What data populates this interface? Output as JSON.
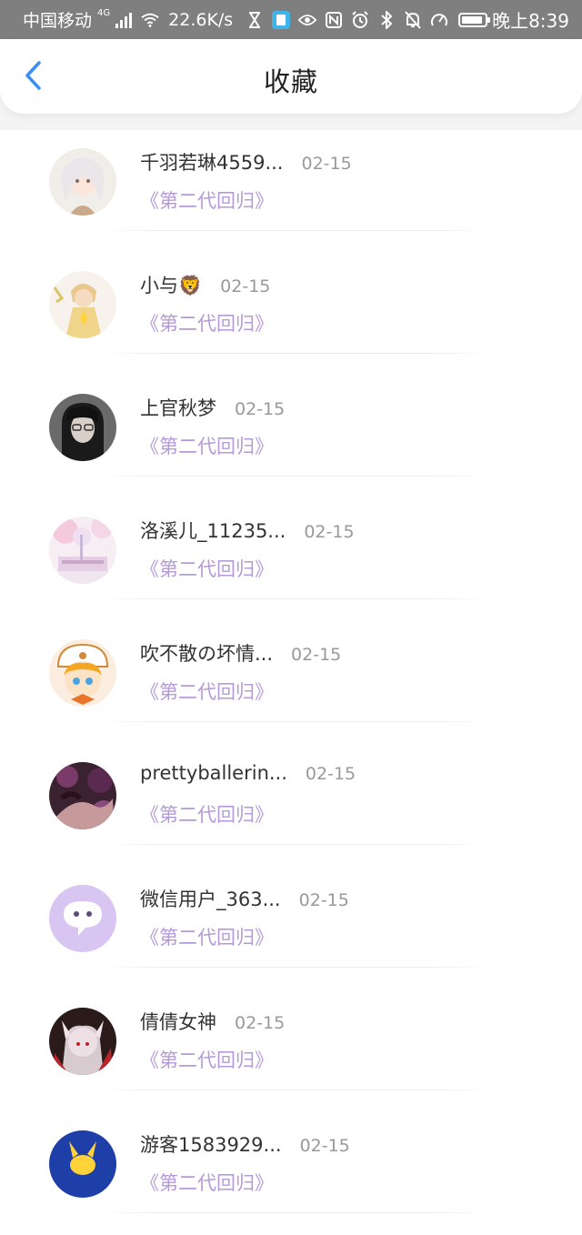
{
  "status_bar": {
    "carrier": "中国移动",
    "network": "4G",
    "speed": "22.6K/s",
    "time": "晚上8:39",
    "battery_level": 0.9
  },
  "header": {
    "title": "收藏",
    "back_icon": "chevron-left-icon",
    "accent_color": "#3b8ff2"
  },
  "items": [
    {
      "name": "千羽若琳4559...",
      "date": "02-15",
      "title": "《第二代回归》",
      "avatar": "anime-girl-white"
    },
    {
      "name": "小与🦁",
      "date": "02-15",
      "title": "《第二代回归》",
      "avatar": "anime-boy-yellow"
    },
    {
      "name": "上官秋梦",
      "date": "02-15",
      "title": "《第二代回归》",
      "avatar": "photo-dark-glasses"
    },
    {
      "name": "洛溪儿_11235...",
      "date": "02-15",
      "title": "《第二代回归》",
      "avatar": "pink-scenery"
    },
    {
      "name": "吹不散の坏情...",
      "date": "02-15",
      "title": "《第二代回归》",
      "avatar": "anime-cat-orange"
    },
    {
      "name": "prettyballerin...",
      "date": "02-15",
      "title": "《第二代回归》",
      "avatar": "dark-purple-art"
    },
    {
      "name": "微信用户_363...",
      "date": "02-15",
      "title": "《第二代回归》",
      "avatar": "wechat-default-purple"
    },
    {
      "name": "倩倩女神",
      "date": "02-15",
      "title": "《第二代回归》",
      "avatar": "anime-fox-red"
    },
    {
      "name": "游客1583929...",
      "date": "02-15",
      "title": "《第二代回归》",
      "avatar": "blue-pikachu"
    }
  ],
  "colors": {
    "title_link": "#b49ad8",
    "name": "#333333",
    "date": "#999999"
  }
}
